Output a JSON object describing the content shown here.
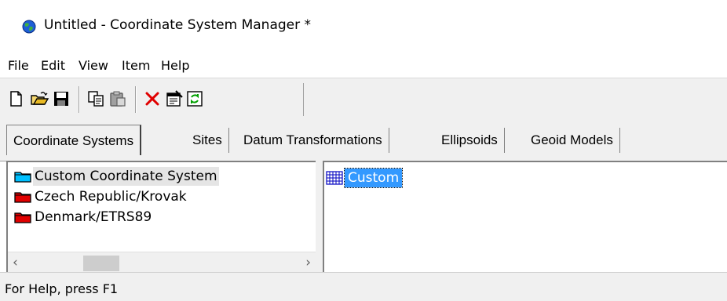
{
  "window": {
    "title": "Untitled - Coordinate System Manager *",
    "icon": "globe-icon"
  },
  "menu": {
    "items": [
      "File",
      "Edit",
      "View",
      "Item",
      "Help"
    ]
  },
  "toolbar": {
    "buttons": [
      "new-icon",
      "open-icon",
      "save-icon",
      "copy-icon",
      "paste-icon",
      "delete-icon",
      "properties-icon",
      "refresh-icon"
    ]
  },
  "tabs": [
    {
      "label": "Coordinate Systems",
      "active": true
    },
    {
      "label": "Sites",
      "active": false
    },
    {
      "label": "Datum Transformations",
      "active": false
    },
    {
      "label": "Ellipsoids",
      "active": false
    },
    {
      "label": "Geoid Models",
      "active": false
    }
  ],
  "tree": {
    "items": [
      {
        "label": "Custom Coordinate System",
        "icon": "folder-cyan-icon",
        "color": "#00c0ff",
        "selected": true
      },
      {
        "label": "Czech Republic/Krovak",
        "icon": "folder-red-icon",
        "color": "#e00000",
        "selected": false
      },
      {
        "label": "Denmark/ETRS89",
        "icon": "folder-red-icon",
        "color": "#e00000",
        "selected": false
      }
    ]
  },
  "list": {
    "items": [
      {
        "label": "Custom",
        "icon": "grid-icon",
        "selected": true
      }
    ]
  },
  "status": {
    "text": "For Help, press F1"
  },
  "colors": {
    "selection": "#3399ff",
    "chrome": "#f0f0f0"
  }
}
